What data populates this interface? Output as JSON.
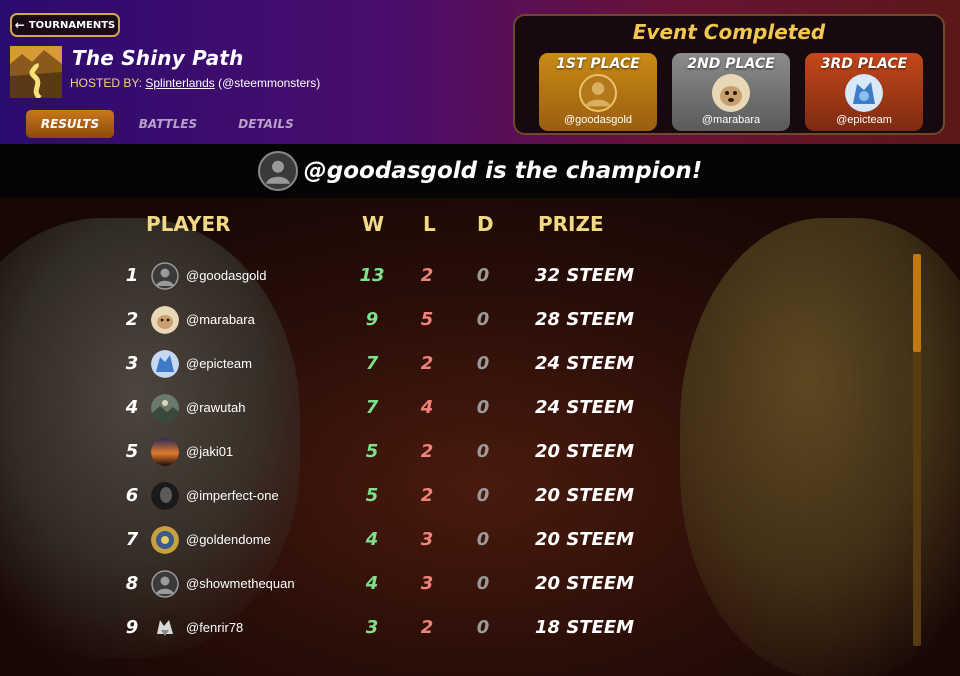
{
  "header": {
    "back_label": "TOURNAMENTS",
    "title": "The Shiny Path",
    "hosted_prefix": "HOSTED BY:",
    "host_name": "Splinterlands",
    "host_handle": "(@steemmonsters)",
    "tabs": [
      {
        "label": "RESULTS",
        "active": true
      },
      {
        "label": "BATTLES",
        "active": false
      },
      {
        "label": "DETAILS",
        "active": false
      }
    ]
  },
  "podium": {
    "title": "Event Completed",
    "places": [
      {
        "label": "1ST PLACE",
        "user": "@goodasgold"
      },
      {
        "label": "2ND PLACE",
        "user": "@marabara"
      },
      {
        "label": "3RD PLACE",
        "user": "@epicteam"
      }
    ]
  },
  "champion": {
    "text": "@goodasgold is the champion!"
  },
  "table": {
    "headers": {
      "player": "PLAYER",
      "w": "W",
      "l": "L",
      "d": "D",
      "prize": "PRIZE"
    },
    "rows": [
      {
        "rank": "1",
        "user": "@goodasgold",
        "w": "13",
        "l": "2",
        "d": "0",
        "prize": "32 STEEM",
        "avatar": "default-avatar-icon"
      },
      {
        "rank": "2",
        "user": "@marabara",
        "w": "9",
        "l": "5",
        "d": "0",
        "prize": "28 STEEM",
        "avatar": "dog-avatar-icon"
      },
      {
        "rank": "3",
        "user": "@epicteam",
        "w": "7",
        "l": "2",
        "d": "0",
        "prize": "24 STEEM",
        "avatar": "blue-creature-avatar-icon"
      },
      {
        "rank": "4",
        "user": "@rawutah",
        "w": "7",
        "l": "4",
        "d": "0",
        "prize": "24 STEEM",
        "avatar": "landscape-avatar-icon"
      },
      {
        "rank": "5",
        "user": "@jaki01",
        "w": "5",
        "l": "2",
        "d": "0",
        "prize": "20 STEEM",
        "avatar": "sunset-avatar-icon"
      },
      {
        "rank": "6",
        "user": "@imperfect-one",
        "w": "5",
        "l": "2",
        "d": "0",
        "prize": "20 STEEM",
        "avatar": "portrait-avatar-icon"
      },
      {
        "rank": "7",
        "user": "@goldendome",
        "w": "4",
        "l": "3",
        "d": "0",
        "prize": "20 STEEM",
        "avatar": "gold-dome-avatar-icon"
      },
      {
        "rank": "8",
        "user": "@showmethequan",
        "w": "4",
        "l": "3",
        "d": "0",
        "prize": "20 STEEM",
        "avatar": "default-avatar-icon"
      },
      {
        "rank": "9",
        "user": "@fenrir78",
        "w": "3",
        "l": "2",
        "d": "0",
        "prize": "18 STEEM",
        "avatar": "wolf-avatar-icon"
      }
    ]
  },
  "colors": {
    "accent_gold": "#f3c84e",
    "win_green": "#7ee08a",
    "loss_red": "#f0837a",
    "draw_gray": "#9a9a9a"
  }
}
